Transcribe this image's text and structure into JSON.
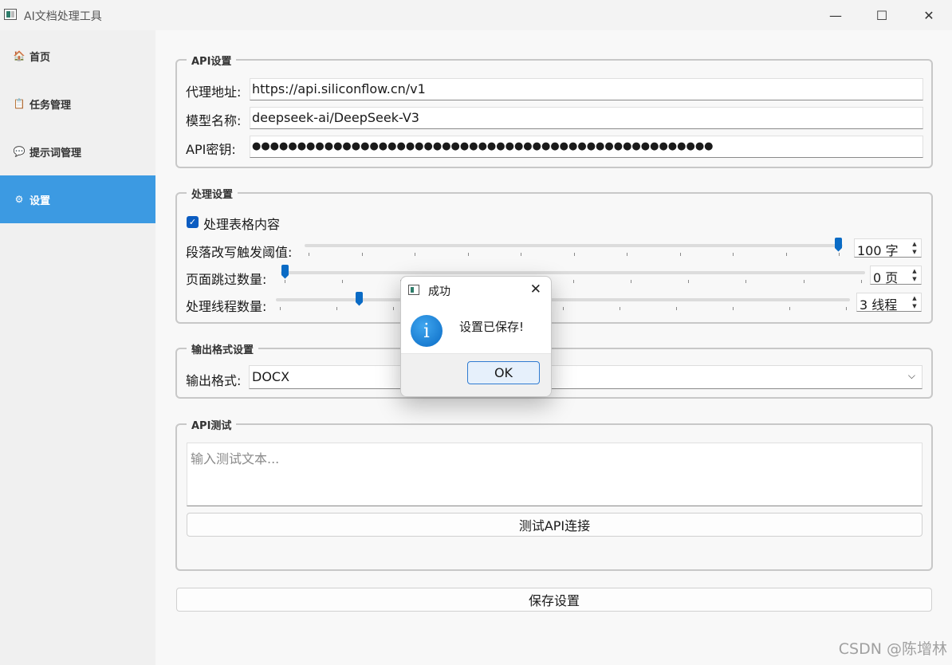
{
  "window": {
    "title": "AI文档处理工具",
    "minimize": "—",
    "maximize": "☐",
    "close": "✕"
  },
  "sidebar": {
    "items": [
      {
        "label": "首页",
        "icon": "home-icon",
        "glyph": "🏠"
      },
      {
        "label": "任务管理",
        "icon": "clipboard-icon",
        "glyph": "📋"
      },
      {
        "label": "提示词管理",
        "icon": "speech-bubble-icon",
        "glyph": "💬"
      },
      {
        "label": "设置",
        "icon": "gear-icon",
        "glyph": "⚙"
      }
    ],
    "active_color": "#3c9ae2"
  },
  "api_settings": {
    "title": "API设置",
    "proxy_label": "代理地址:",
    "proxy_value": "https://api.siliconflow.cn/v1",
    "model_label": "模型名称:",
    "model_value": "deepseek-ai/DeepSeek-V3",
    "key_label": "API密钥:",
    "key_value": "●●●●●●●●●●●●●●●●●●●●●●●●●●●●●●●●●●●●●●●●●●●●●●●●●●●"
  },
  "processing": {
    "title": "处理设置",
    "table_checkbox_label": "处理表格内容",
    "table_checkbox_checked": true,
    "threshold_label": "段落改写触发阈值:",
    "threshold_value": "100 字",
    "threshold_fraction": 1.0,
    "skip_label": "页面跳过数量:",
    "skip_value": "0 页",
    "skip_fraction": 0.0,
    "threads_label": "处理线程数量:",
    "threads_value": "3 线程",
    "threads_fraction": 0.14
  },
  "output": {
    "title": "输出格式设置",
    "label": "输出格式:",
    "value": "DOCX"
  },
  "api_test": {
    "title": "API测试",
    "placeholder": "输入测试文本...",
    "button_label": "测试API连接"
  },
  "save_button_label": "保存设置",
  "dialog": {
    "title": "成功",
    "message": "设置已保存!",
    "ok_label": "OK",
    "info_glyph": "i",
    "close": "✕"
  },
  "watermark": "CSDN @陈增林",
  "colors": {
    "accent": "#3c9ae2",
    "checkbox": "#0b5cc1",
    "slider_thumb": "#0a6bc5"
  }
}
